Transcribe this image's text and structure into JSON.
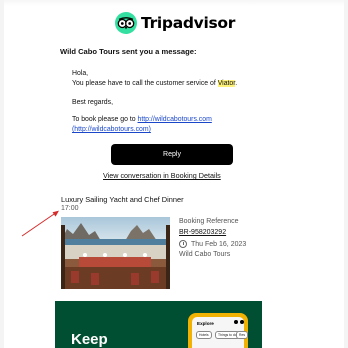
{
  "brand": {
    "name": "Tripadvisor",
    "accent": "#34e0a1"
  },
  "email": {
    "sender_line": "Wild Cabo Tours sent you a message:",
    "greeting": "Hola,",
    "body_prefix": "You please have to call the customer service of ",
    "body_highlight": "Viator",
    "body_suffix": ".",
    "signoff": "Best regards,",
    "booking_prefix": "To book please go to ",
    "booking_link": "http://wildcabotours.com",
    "booking_link_paren": "(http://wildcabotours.com)",
    "reply_label": "Reply",
    "view_conversation": "View conversation in Booking Details"
  },
  "booking": {
    "title": "Luxury Sailing Yacht and Chef Dinner",
    "time": "17:00",
    "reference_label": "Booking Reference",
    "reference": "BR-958203292",
    "date": "Thu Feb 16, 2023",
    "operator": "Wild Cabo Tours"
  },
  "promo": {
    "headline": "Keep",
    "app_title": "Explore",
    "chips": [
      "Hotels",
      "Things to do",
      "Res"
    ]
  },
  "icons": [
    "tripadvisor-owl-icon",
    "clock-icon",
    "annotation-arrow"
  ]
}
